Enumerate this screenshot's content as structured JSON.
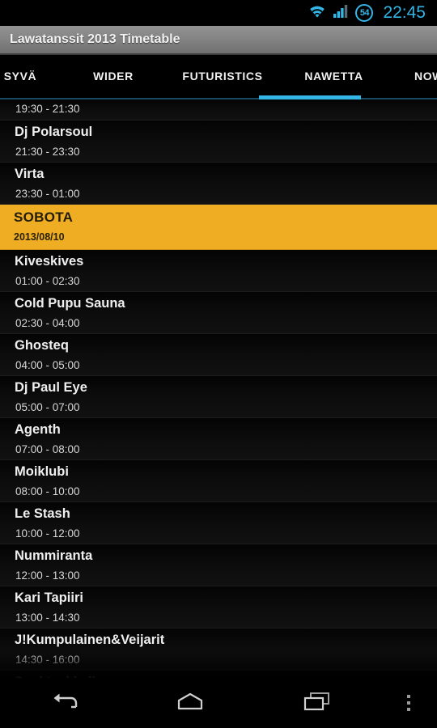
{
  "statusbar": {
    "wifi_icon": "wifi-icon",
    "signal_icon": "cellular-signal-icon",
    "battery_level": "54",
    "time": "22:45",
    "accent_color": "#33b5e5"
  },
  "titlebar": {
    "title": "Lawatanssit 2013 Timetable"
  },
  "tabs": {
    "active_index": 3,
    "active_color": "#33b5e5",
    "items": [
      {
        "label": "SYVÄ"
      },
      {
        "label": "WIDER"
      },
      {
        "label": "FUTURISTICS"
      },
      {
        "label": "NAWETTA"
      },
      {
        "label": "NOW"
      }
    ]
  },
  "list": {
    "day_header_color": "#eead22",
    "rows": [
      {
        "kind": "event",
        "clipped": true,
        "title": "",
        "time": "19:30 - 21:30"
      },
      {
        "kind": "event",
        "title": "Dj Polarsoul",
        "time": "21:30 - 23:30"
      },
      {
        "kind": "event",
        "title": "Virta",
        "time": "23:30 - 01:00"
      },
      {
        "kind": "day",
        "title": "SOBOTA",
        "time": "2013/08/10"
      },
      {
        "kind": "event",
        "title": "Kiveskives",
        "time": "01:00 - 02:30"
      },
      {
        "kind": "event",
        "title": "Cold Pupu Sauna",
        "time": "02:30 - 04:00"
      },
      {
        "kind": "event",
        "title": "Ghosteq",
        "time": "04:00 - 05:00"
      },
      {
        "kind": "event",
        "title": "Dj Paul Eye",
        "time": "05:00 - 07:00"
      },
      {
        "kind": "event",
        "title": "Agenth",
        "time": "07:00 - 08:00"
      },
      {
        "kind": "event",
        "title": "Moiklubi",
        "time": "08:00 - 10:00"
      },
      {
        "kind": "event",
        "title": "Le Stash",
        "time": "10:00 - 12:00"
      },
      {
        "kind": "event",
        "title": "Nummiranta",
        "time": "12:00 - 13:00"
      },
      {
        "kind": "event",
        "title": "Kari Tapiiri",
        "time": "13:00 - 14:30"
      },
      {
        "kind": "event",
        "title": "J!Kumpulainen&Veijarit",
        "time": "14:30 - 16:00"
      },
      {
        "kind": "event",
        "title": "Spektaakkeli",
        "time": ""
      }
    ]
  },
  "navbar": {
    "back": "back-icon",
    "home": "home-icon",
    "recents": "recent-apps-icon",
    "overflow": "overflow-menu-icon"
  }
}
